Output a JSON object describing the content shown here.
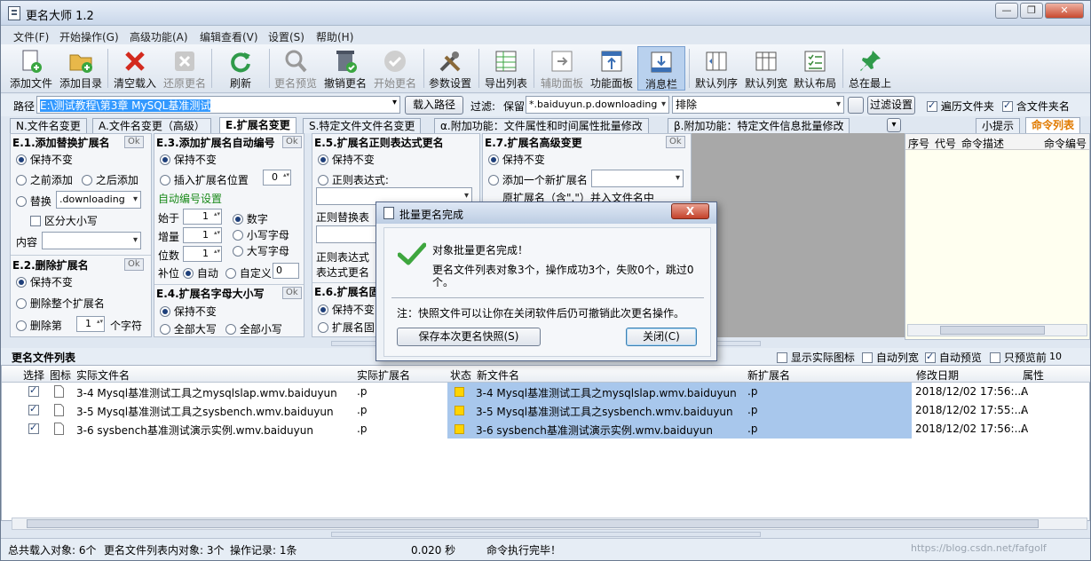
{
  "window": {
    "title": "更名大师 1.2"
  },
  "menu": [
    "文件(F)",
    "开始操作(G)",
    "高级功能(A)",
    "编辑查看(V)",
    "设置(S)",
    "帮助(H)"
  ],
  "toolbar": [
    {
      "label": "添加文件",
      "icon": "add-file-icon"
    },
    {
      "label": "添加目录",
      "icon": "add-folder-icon"
    },
    {
      "label": "清空载入",
      "icon": "clear-x-icon"
    },
    {
      "label": "还原更名",
      "icon": "restore-icon"
    },
    {
      "label": "刷新",
      "icon": "refresh-icon"
    },
    {
      "label": "更名预览",
      "icon": "preview-icon"
    },
    {
      "label": "撤销更名",
      "icon": "undo-icon"
    },
    {
      "label": "开始更名",
      "icon": "start-icon"
    },
    {
      "label": "参数设置",
      "icon": "tools-icon"
    },
    {
      "label": "导出列表",
      "icon": "export-icon"
    },
    {
      "label": "辅助面板",
      "icon": "aux-panel-icon"
    },
    {
      "label": "功能面板",
      "icon": "func-panel-icon"
    },
    {
      "label": "消息栏",
      "icon": "message-bar-icon"
    },
    {
      "label": "默认列序",
      "icon": "col-order-icon"
    },
    {
      "label": "默认列宽",
      "icon": "col-width-icon"
    },
    {
      "label": "默认布局",
      "icon": "layout-icon"
    },
    {
      "label": "总在最上",
      "icon": "pin-icon"
    }
  ],
  "path": {
    "label": "路径",
    "value": "E:\\测试教程\\第3章 MySQL基准测试",
    "load_button": "载入路径",
    "filter_label": "过滤:",
    "keep_label": "保留",
    "keep_value": "*.baiduyun.p.downloading",
    "exclude_value": "排除",
    "filter_button": "过滤设置",
    "opt_traverse": "遍历文件夹",
    "opt_folder_name": "含文件夹名"
  },
  "tabs": [
    "N.文件名变更",
    "A.文件名变更（高级）",
    "E.扩展名变更",
    "S.特定文件文件名变更",
    "α.附加功能：文件属性和时间属性批量修改",
    "β.附加功能：特定文件信息批量修改"
  ],
  "right_tabs": [
    "小提示",
    "命令列表"
  ],
  "e1": {
    "title": "E.1.添加替换扩展名",
    "ok": "Ok",
    "keep": "保持不变",
    "prepend": "之前添加",
    "append": "之后添加",
    "replace": "替换",
    "replace_value": ".downloading",
    "case": "区分大小写",
    "content": "内容"
  },
  "e2": {
    "title": "E.2.删除扩展名",
    "ok": "Ok",
    "keep": "保持不变",
    "delete_all": "删除整个扩展名",
    "delete_n": "删除第",
    "n_value": "1",
    "n_suffix": "个字符"
  },
  "e3": {
    "title": "E.3.添加扩展名自动编号",
    "ok": "Ok",
    "keep": "保持不变",
    "insert_pos": "插入扩展名位置",
    "pos_value": "0",
    "auto_title": "自动编号设置",
    "start_label": "始于",
    "start": "1",
    "inc_label": "增量",
    "inc": "1",
    "digits_label": "位数",
    "digits": "1",
    "digit": "数字",
    "lower": "小写字母",
    "upper": "大写字母",
    "pad_label": "补位",
    "auto": "自动",
    "custom": "自定义",
    "custom_value": "0"
  },
  "e4": {
    "title": "E.4.扩展名字母大小写",
    "ok": "Ok",
    "keep": "保持不变",
    "all_upper": "全部大写",
    "all_lower": "全部小写"
  },
  "e5": {
    "title": "E.5.扩展名正则表达式更名",
    "ok": "Ok",
    "keep": "保持不变",
    "regex": "正则表达式:",
    "replace_label": "正则替换表",
    "test_label": "正则表达式",
    "test_label2": "表达式更名"
  },
  "e6": {
    "title": "E.6.扩展名固",
    "keep": "保持不变",
    "fixed": "扩展名固"
  },
  "e7": {
    "title": "E.7.扩展名高级变更",
    "ok": "Ok",
    "keep": "保持不变",
    "add_new": "添加一个新扩展名",
    "orig_into_name": "原扩展名（含\".\"）并入文件名中"
  },
  "cmd_list": {
    "headers": [
      "序号",
      "代号",
      "命令描述",
      "命令编号"
    ]
  },
  "file_list": {
    "title": "更名文件列表",
    "opt_show_icon": "显示实际图标",
    "opt_auto_width": "自动列宽",
    "opt_auto_preview": "自动预览",
    "opt_preview_first": "只预览前",
    "preview_count": "10",
    "headers": [
      "选择",
      "图标",
      "实际文件名",
      "实际扩展名",
      "状态",
      "新文件名",
      "新扩展名",
      "修改日期",
      "属性"
    ],
    "rows": [
      {
        "name": "3-4 Mysql基准测试工具之mysqlslap.wmv.baiduyun",
        "ext": ".p",
        "new_name": "3-4 Mysql基准测试工具之mysqlslap.wmv.baiduyun",
        "new_ext": ".p",
        "date": "2018/12/02 17:56:...",
        "attr": "A"
      },
      {
        "name": "3-5 Mysql基准测试工具之sysbench.wmv.baiduyun",
        "ext": ".p",
        "new_name": "3-5 Mysql基准测试工具之sysbench.wmv.baiduyun",
        "new_ext": ".p",
        "date": "2018/12/02 17:55:...",
        "attr": "A"
      },
      {
        "name": "3-6 sysbench基准测试演示实例.wmv.baiduyun",
        "ext": ".p",
        "new_name": "3-6 sysbench基准测试演示实例.wmv.baiduyun",
        "new_ext": ".p",
        "date": "2018/12/02 17:56:...",
        "attr": "A"
      }
    ]
  },
  "status": {
    "total": "总共载入对象: 6个",
    "in_list": "更名文件列表内对象: 3个",
    "log": "操作记录: 1条",
    "time": "0.020 秒",
    "msg": "命令执行完毕！",
    "watermark": "https://blog.csdn.net/fafgolf"
  },
  "dialog": {
    "title": "批量更名完成",
    "close_x": "X",
    "heading": "对象批量更名完成！",
    "detail": "更名文件列表对象3个，操作成功3个，失败0个，跳过0个。",
    "note": "注：快照文件可以让你在关闭软件后仍可撤销此次更名操作。",
    "save_button": "保存本次更名快照(S)",
    "close_button": "关闭(C)"
  }
}
